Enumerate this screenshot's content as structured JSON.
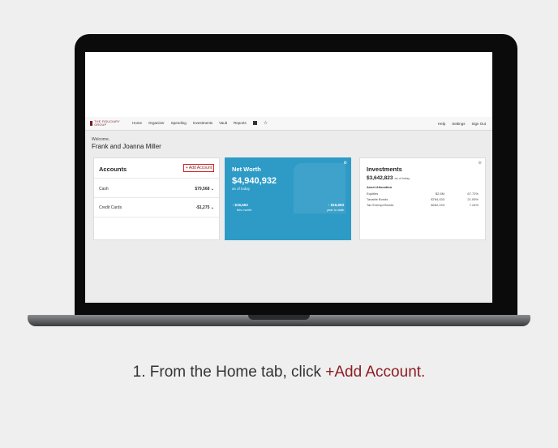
{
  "nav": {
    "logo_text": "THE FIDUCIARY GROUP",
    "items": [
      "Home",
      "Organizer",
      "Spending",
      "Investments",
      "Vault",
      "Reports"
    ],
    "right_items": [
      "Help",
      "Settings",
      "Sign Out"
    ]
  },
  "welcome": {
    "greeting": "Welcome,",
    "names": "Frank and Joanna Miller"
  },
  "accounts": {
    "title": "Accounts",
    "add_label": "+ Add Account",
    "rows": [
      {
        "label": "Cash",
        "value": "$79,568"
      },
      {
        "label": "Credit Cards",
        "value": "-$1,275"
      }
    ]
  },
  "net_worth": {
    "title": "Net Worth",
    "value": "$4,940,932",
    "as_of": "as of today",
    "month_change": "↑ $16,563",
    "month_label": "this month",
    "ytd_change": "↑ $16,563",
    "ytd_label": "year to date"
  },
  "investments": {
    "title": "Investments",
    "value": "$3,642,823",
    "as_of": "as of today",
    "allocation_title": "Asset Allocation",
    "rows": [
      {
        "name": "Equities",
        "amount": "$2.5M",
        "pct": "67.72%"
      },
      {
        "name": "Taxable Bonds",
        "amount": "$784,433",
        "pct": "21.05%"
      },
      {
        "name": "Tax Exempt Bonds",
        "amount": "$262,243",
        "pct": "7.24%"
      }
    ]
  },
  "caption": {
    "prefix": "1. From the Home tab, click ",
    "highlight": "+Add Account."
  },
  "colors": {
    "accent": "#8c1d23",
    "networth_bg": "#2e9bc7",
    "add_border": "#d32121"
  }
}
